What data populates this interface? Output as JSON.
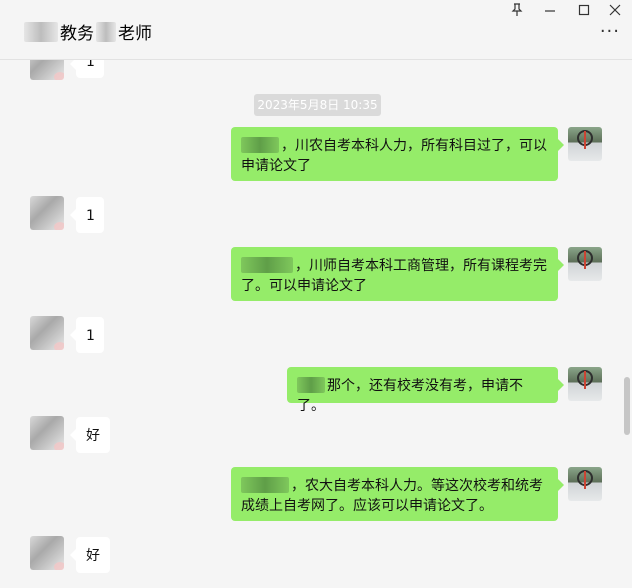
{
  "header": {
    "title_part1": "教务",
    "title_part2": "老师",
    "pin_icon": "pin-icon",
    "minimize_icon": "minimize-icon",
    "maximize_icon": "maximize-icon",
    "close_icon": "close-icon",
    "more_icon": "more-icon"
  },
  "chat": {
    "timestamp": "2023年5月8日 10:35",
    "messages": [
      {
        "side": "left",
        "text": "1"
      },
      {
        "side": "right",
        "text": "，川农自考本科人力，所有科目过了，可以申请论文了"
      },
      {
        "side": "left",
        "text": "1"
      },
      {
        "side": "right",
        "text": "，川师自考本科工商管理，所有课程考完了。可以申请论文了"
      },
      {
        "side": "left",
        "text": "1"
      },
      {
        "side": "right",
        "text": "那个，还有校考没有考，申请不了。"
      },
      {
        "side": "left",
        "text": "好"
      },
      {
        "side": "right",
        "text": "，农大自考本科人力。等这次校考和统考成绩上自考网了。应该可以申请论文了。"
      },
      {
        "side": "left",
        "text": "好"
      }
    ]
  },
  "colors": {
    "bubble_right": "#95ec69",
    "bubble_left": "#ffffff",
    "background": "#f5f5f5",
    "timestamp_bg": "#dadada"
  }
}
